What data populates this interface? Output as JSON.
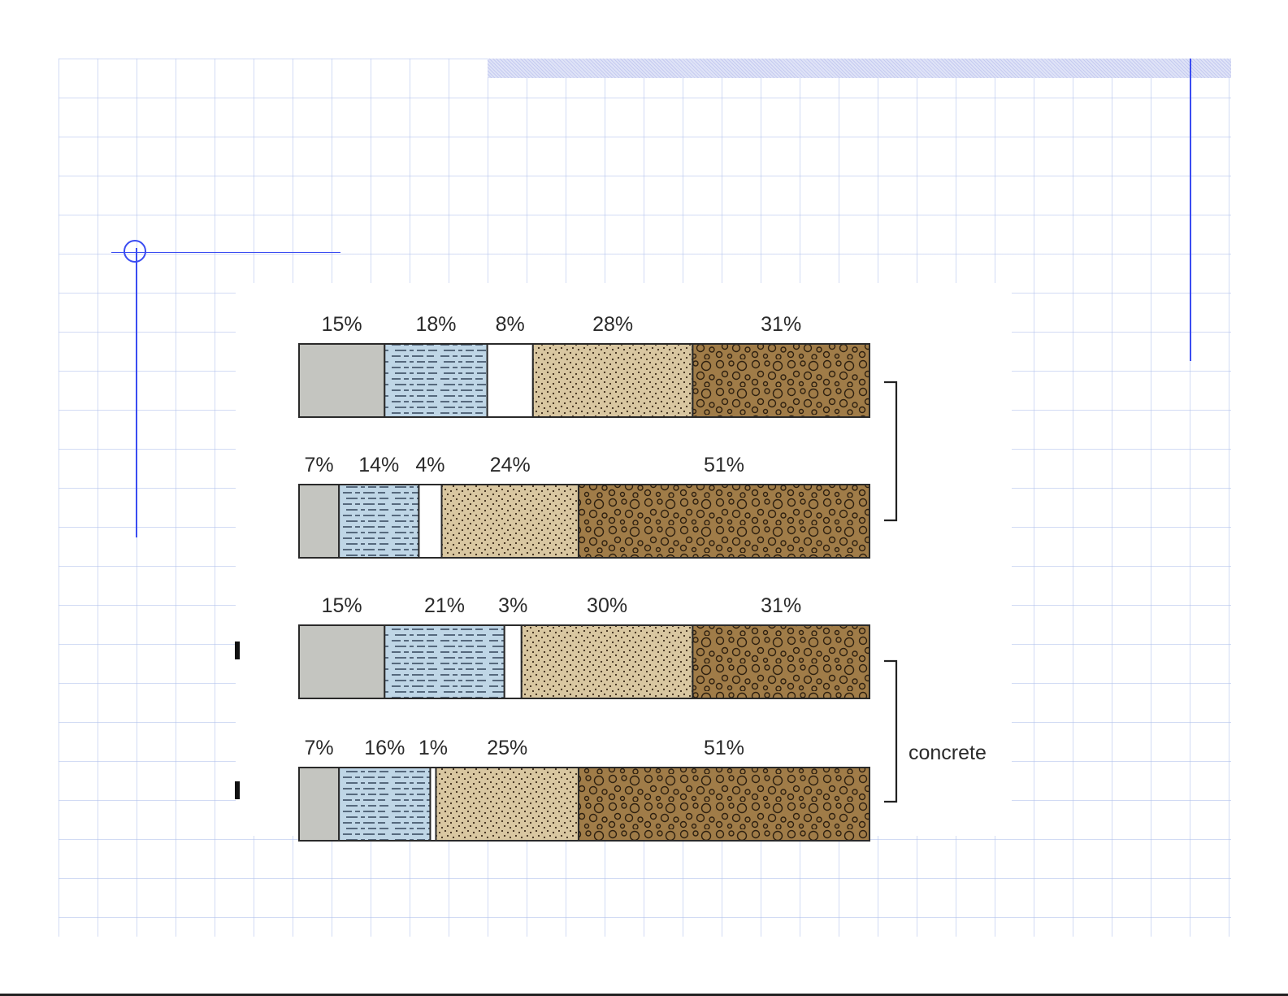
{
  "chart_data": {
    "type": "bar",
    "orientation": "horizontal",
    "stacked": true,
    "grid": false,
    "component_colors": [
      "#c4c5c0",
      "#bfd6e6",
      "#ffffff",
      "#d9c7a1",
      "#a07c48"
    ],
    "bars": [
      {
        "values": [
          15,
          18,
          8,
          28,
          31
        ],
        "labels": [
          "15%",
          "18%",
          "8%",
          "28%",
          "31%"
        ]
      },
      {
        "values": [
          7,
          14,
          4,
          24,
          51
        ],
        "labels": [
          "7%",
          "14%",
          "4%",
          "24%",
          "51%"
        ]
      },
      {
        "values": [
          15,
          21,
          3,
          30,
          31
        ],
        "labels": [
          "15%",
          "21%",
          "3%",
          "30%",
          "31%"
        ]
      },
      {
        "values": [
          7,
          16,
          1,
          25,
          51
        ],
        "labels": [
          "7%",
          "16%",
          "1%",
          "25%",
          "51%"
        ]
      }
    ],
    "annotations": [
      "concrete"
    ]
  }
}
